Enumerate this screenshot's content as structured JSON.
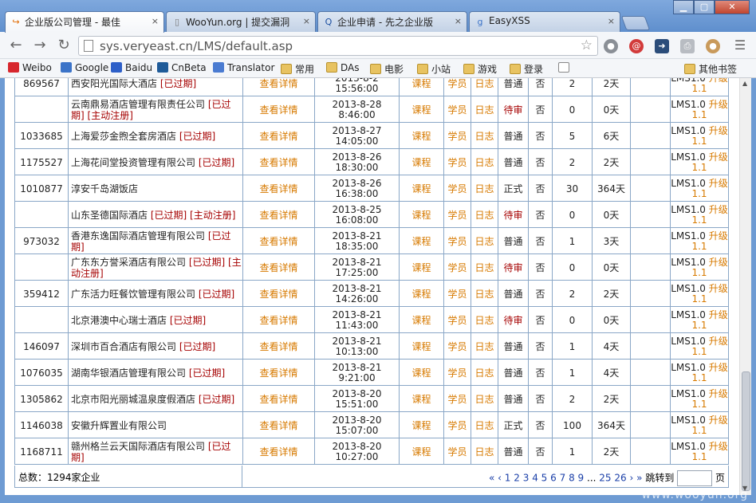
{
  "browser": {
    "tabs": [
      {
        "title": "企业版公司管理 - 最佳",
        "favicon": "veryeast-icon",
        "active": true
      },
      {
        "title": "WooYun.org | 提交漏洞",
        "favicon": "page-icon",
        "active": false
      },
      {
        "title": "企业申请 - 先之企业版",
        "favicon": "qlb-icon",
        "active": false
      },
      {
        "title": "EasyXSS",
        "favicon": "google-icon",
        "active": false
      }
    ],
    "url": "sys.veryeast.cn/LMS/default.asp",
    "window_buttons": {
      "minimize": "▁",
      "maximize": "▢",
      "close": "✕"
    }
  },
  "bookmarks": [
    {
      "label": "Weibo",
      "icon": "weibo-icon"
    },
    {
      "label": "Google",
      "icon": "google-icon"
    },
    {
      "label": "Baidu",
      "icon": "baidu-icon"
    },
    {
      "label": "CnBeta",
      "icon": "cnbeta-icon"
    },
    {
      "label": "Translator",
      "icon": "translator-icon"
    },
    {
      "label": "常用",
      "icon": "folder-icon"
    },
    {
      "label": "DAs",
      "icon": "folder-icon"
    },
    {
      "label": "电影",
      "icon": "folder-icon"
    },
    {
      "label": "小站",
      "icon": "folder-icon"
    },
    {
      "label": "游戏",
      "icon": "folder-icon"
    },
    {
      "label": "登录",
      "icon": "folder-icon"
    },
    {
      "label": "",
      "icon": "page-icon"
    },
    {
      "label": "其他书签",
      "icon": "folder-icon"
    }
  ],
  "table": {
    "detail_link": "查看详情",
    "course_link": "课程",
    "student_link": "学员",
    "log_link": "日志",
    "no_label": "否",
    "expired_tag": "[已过期]",
    "active_reg_tag": "[主动注册]",
    "lms_label": "LMS1.0",
    "upgrade_link": "升级",
    "lms_version": "1.1",
    "rows": [
      {
        "id": "869567",
        "company": "西安阳光国际大酒店",
        "expired": true,
        "active_reg": false,
        "date": "2013-8-2",
        "time": "15:56:00",
        "status": "普通",
        "pending": false,
        "n": "2",
        "days": "2天"
      },
      {
        "id": "",
        "company": "云南鼎易酒店管理有限责任公司",
        "expired": true,
        "active_reg": true,
        "date": "2013-8-28 8:46:00",
        "time": "",
        "status": "待审",
        "pending": true,
        "n": "0",
        "days": "0天"
      },
      {
        "id": "1033685",
        "company": "上海爱莎金煦全套房酒店",
        "expired": true,
        "active_reg": false,
        "date": "2013-8-27",
        "time": "14:05:00",
        "status": "普通",
        "pending": false,
        "n": "5",
        "days": "6天"
      },
      {
        "id": "1175527",
        "company": "上海花间堂投资管理有限公司",
        "expired": true,
        "active_reg": false,
        "date": "2013-8-26",
        "time": "18:30:00",
        "status": "普通",
        "pending": false,
        "n": "2",
        "days": "2天"
      },
      {
        "id": "1010877",
        "company": "淳安千岛湖饭店",
        "expired": false,
        "active_reg": false,
        "date": "2013-8-26",
        "time": "16:38:00",
        "status": "正式",
        "pending": false,
        "n": "30",
        "days": "364天"
      },
      {
        "id": "",
        "company": "山东圣德国际酒店",
        "expired": true,
        "active_reg": true,
        "date": "2013-8-25",
        "time": "16:08:00",
        "status": "待审",
        "pending": true,
        "n": "0",
        "days": "0天"
      },
      {
        "id": "973032",
        "company": "香港东逸国际酒店管理有限公司",
        "expired": true,
        "active_reg": false,
        "date": "2013-8-21",
        "time": "18:35:00",
        "status": "普通",
        "pending": false,
        "n": "1",
        "days": "3天"
      },
      {
        "id": "",
        "company": "广东东方誉采酒店有限公司",
        "expired": true,
        "active_reg": true,
        "date": "2013-8-21",
        "time": "17:25:00",
        "status": "待审",
        "pending": true,
        "n": "0",
        "days": "0天"
      },
      {
        "id": "359412",
        "company": "广东活力旺餐饮管理有限公司",
        "expired": true,
        "active_reg": false,
        "date": "2013-8-21",
        "time": "14:26:00",
        "status": "普通",
        "pending": false,
        "n": "2",
        "days": "2天"
      },
      {
        "id": "",
        "company": "北京港澳中心瑞士酒店",
        "expired": true,
        "active_reg": false,
        "date": "2013-8-21",
        "time": "11:43:00",
        "status": "待审",
        "pending": true,
        "n": "0",
        "days": "0天"
      },
      {
        "id": "146097",
        "company": "深圳市百合酒店有限公司",
        "expired": true,
        "active_reg": false,
        "date": "2013-8-21",
        "time": "10:13:00",
        "status": "普通",
        "pending": false,
        "n": "1",
        "days": "4天"
      },
      {
        "id": "1076035",
        "company": "湖南华银酒店管理有限公司",
        "expired": true,
        "active_reg": false,
        "date": "2013-8-21 9:21:00",
        "time": "",
        "status": "普通",
        "pending": false,
        "n": "1",
        "days": "4天"
      },
      {
        "id": "1305862",
        "company": "北京市阳光丽城温泉度假酒店",
        "expired": true,
        "active_reg": false,
        "date": "2013-8-20",
        "time": "15:51:00",
        "status": "普通",
        "pending": false,
        "n": "2",
        "days": "2天"
      },
      {
        "id": "1146038",
        "company": "安徽升辉置业有限公司",
        "expired": false,
        "active_reg": false,
        "date": "2013-8-20",
        "time": "15:07:00",
        "status": "正式",
        "pending": false,
        "n": "100",
        "days": "364天"
      },
      {
        "id": "1168711",
        "company": "赣州格兰云天国际酒店有限公司",
        "expired": true,
        "active_reg": false,
        "date": "2013-8-20",
        "time": "10:27:00",
        "status": "普通",
        "pending": false,
        "n": "1",
        "days": "2天"
      }
    ]
  },
  "footer": {
    "total": "总数：1294家企业",
    "pager_first": "«",
    "pager_prev": "‹",
    "pages": [
      "1",
      "2",
      "3",
      "4",
      "5",
      "6",
      "7",
      "8",
      "9"
    ],
    "ellipsis": "...",
    "tail_pages": [
      "25",
      "26"
    ],
    "pager_next": "›",
    "pager_last": "»",
    "jump_label": "跳转到",
    "page_suffix": "页"
  },
  "watermark": "www.wooyun.org"
}
